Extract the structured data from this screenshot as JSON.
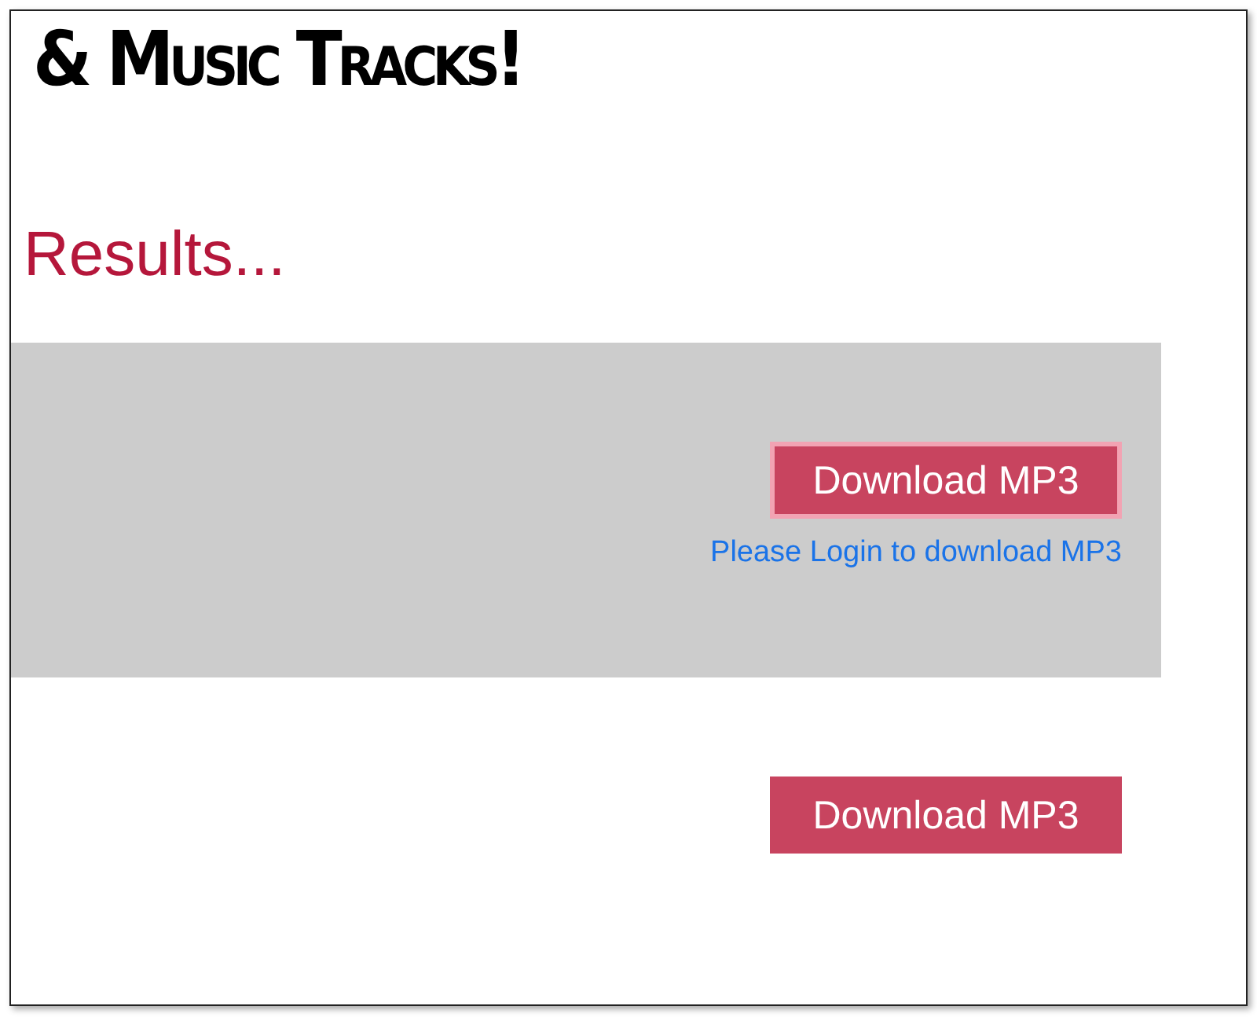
{
  "logo": {
    "text": "& Music Tracks!"
  },
  "heading": "Results...",
  "results": [
    {
      "shaded": true,
      "button": {
        "label": "Download MP3",
        "focused": true
      },
      "login_link": "Please Login to download MP3"
    },
    {
      "shaded": false,
      "button": {
        "label": "Download MP3",
        "focused": false
      }
    }
  ]
}
